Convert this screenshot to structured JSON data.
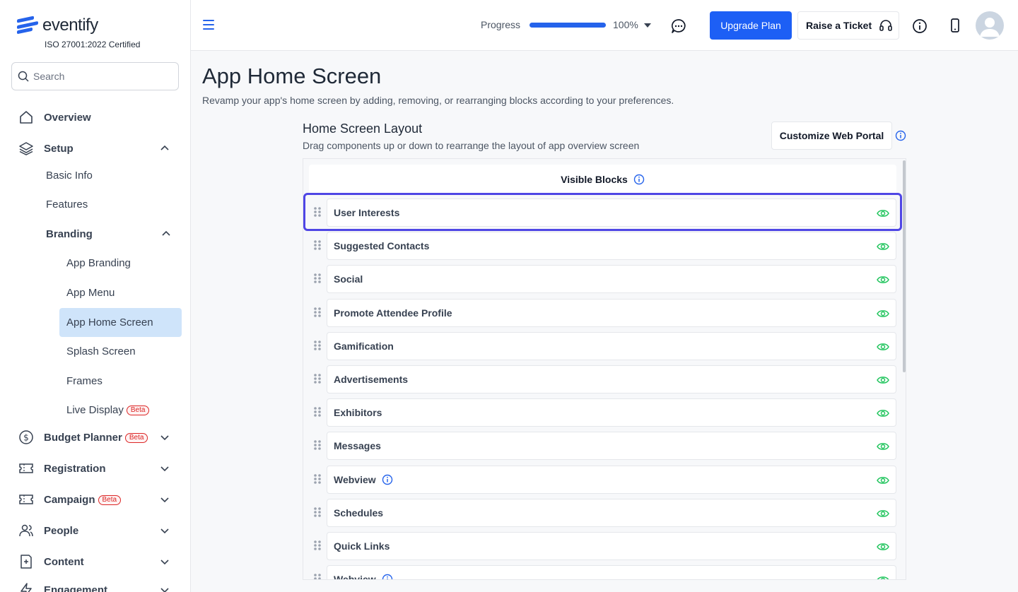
{
  "brand": {
    "name": "eventify",
    "certification": "ISO 27001:2022 Certified",
    "accent": "#2563eb"
  },
  "search": {
    "placeholder": "Search"
  },
  "sidebar": {
    "overview": "Overview",
    "setup": "Setup",
    "setup_items": {
      "basic_info": "Basic Info",
      "features": "Features",
      "branding": "Branding"
    },
    "branding_items": {
      "app_branding": "App Branding",
      "app_menu": "App Menu",
      "app_home_screen": "App Home Screen",
      "splash_screen": "Splash Screen",
      "frames": "Frames",
      "live_display": "Live Display"
    },
    "beta_badge": "Beta",
    "budget_planner": "Budget Planner",
    "registration": "Registration",
    "campaign": "Campaign",
    "people": "People",
    "content": "Content",
    "engagement": "Engagement",
    "active_item": "App Home Screen"
  },
  "topbar": {
    "progress_label": "Progress",
    "progress_value": 100,
    "progress_text": "100%",
    "upgrade_label": "Upgrade Plan",
    "ticket_label": "Raise a Ticket"
  },
  "page": {
    "title": "App Home Screen",
    "subtitle": "Revamp your app's home screen by adding, removing, or rearranging blocks according to your preferences."
  },
  "layout_section": {
    "title": "Home Screen Layout",
    "subtitle": "Drag components up or down to rearrange the layout of app overview screen",
    "customize_label": "Customize Web Portal",
    "visible_blocks_label": "Visible Blocks"
  },
  "blocks": [
    {
      "label": "User Interests",
      "info": false
    },
    {
      "label": "Suggested Contacts",
      "info": false
    },
    {
      "label": "Social",
      "info": false
    },
    {
      "label": "Promote Attendee Profile",
      "info": false
    },
    {
      "label": "Gamification",
      "info": false
    },
    {
      "label": "Advertisements",
      "info": false
    },
    {
      "label": "Exhibitors",
      "info": false
    },
    {
      "label": "Messages",
      "info": false
    },
    {
      "label": "Webview",
      "info": true
    },
    {
      "label": "Schedules",
      "info": false
    },
    {
      "label": "Quick Links",
      "info": false
    },
    {
      "label": "Webview",
      "info": true
    }
  ],
  "colors": {
    "eye": "#22c55e",
    "highlight": "#4f46e5",
    "active_bg": "#cfe4fa"
  }
}
